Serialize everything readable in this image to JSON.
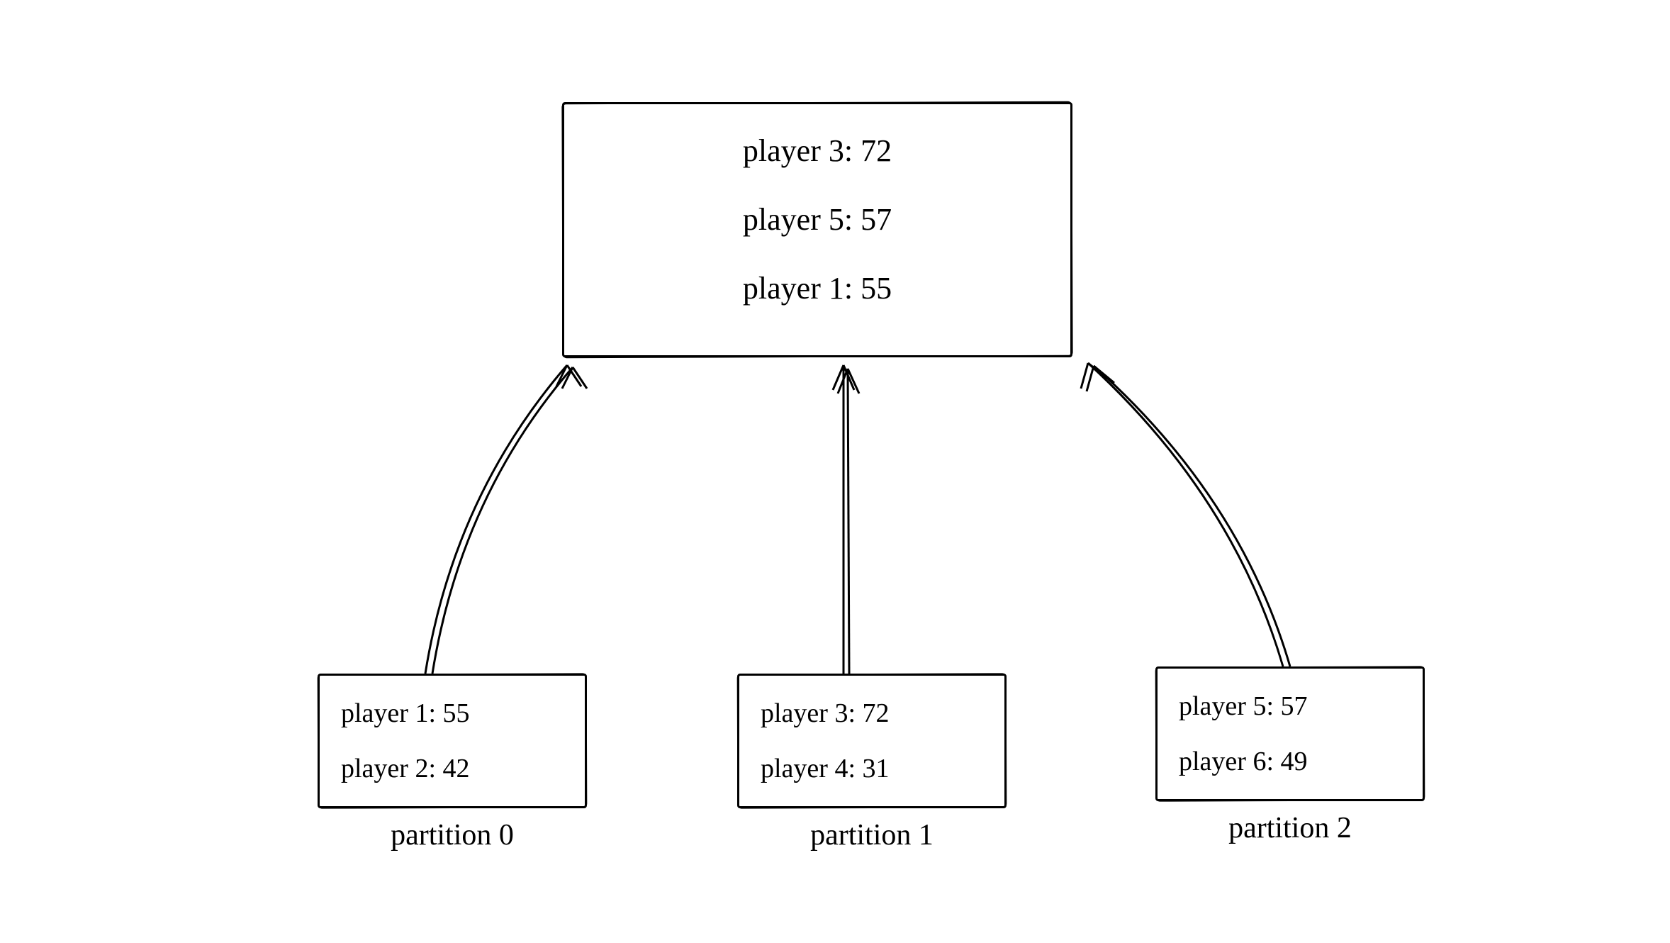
{
  "aggregate": {
    "rows": [
      "player 3: 72",
      "player 5: 57",
      "player 1: 55"
    ]
  },
  "partitions": [
    {
      "label": "partition 0",
      "rows": [
        "player 1: 55",
        "player 2: 42"
      ]
    },
    {
      "label": "partition 1",
      "rows": [
        "player 3: 72",
        "player 4: 31"
      ]
    },
    {
      "label": "partition 2",
      "rows": [
        "player 5: 57",
        "player 6: 49"
      ]
    }
  ]
}
